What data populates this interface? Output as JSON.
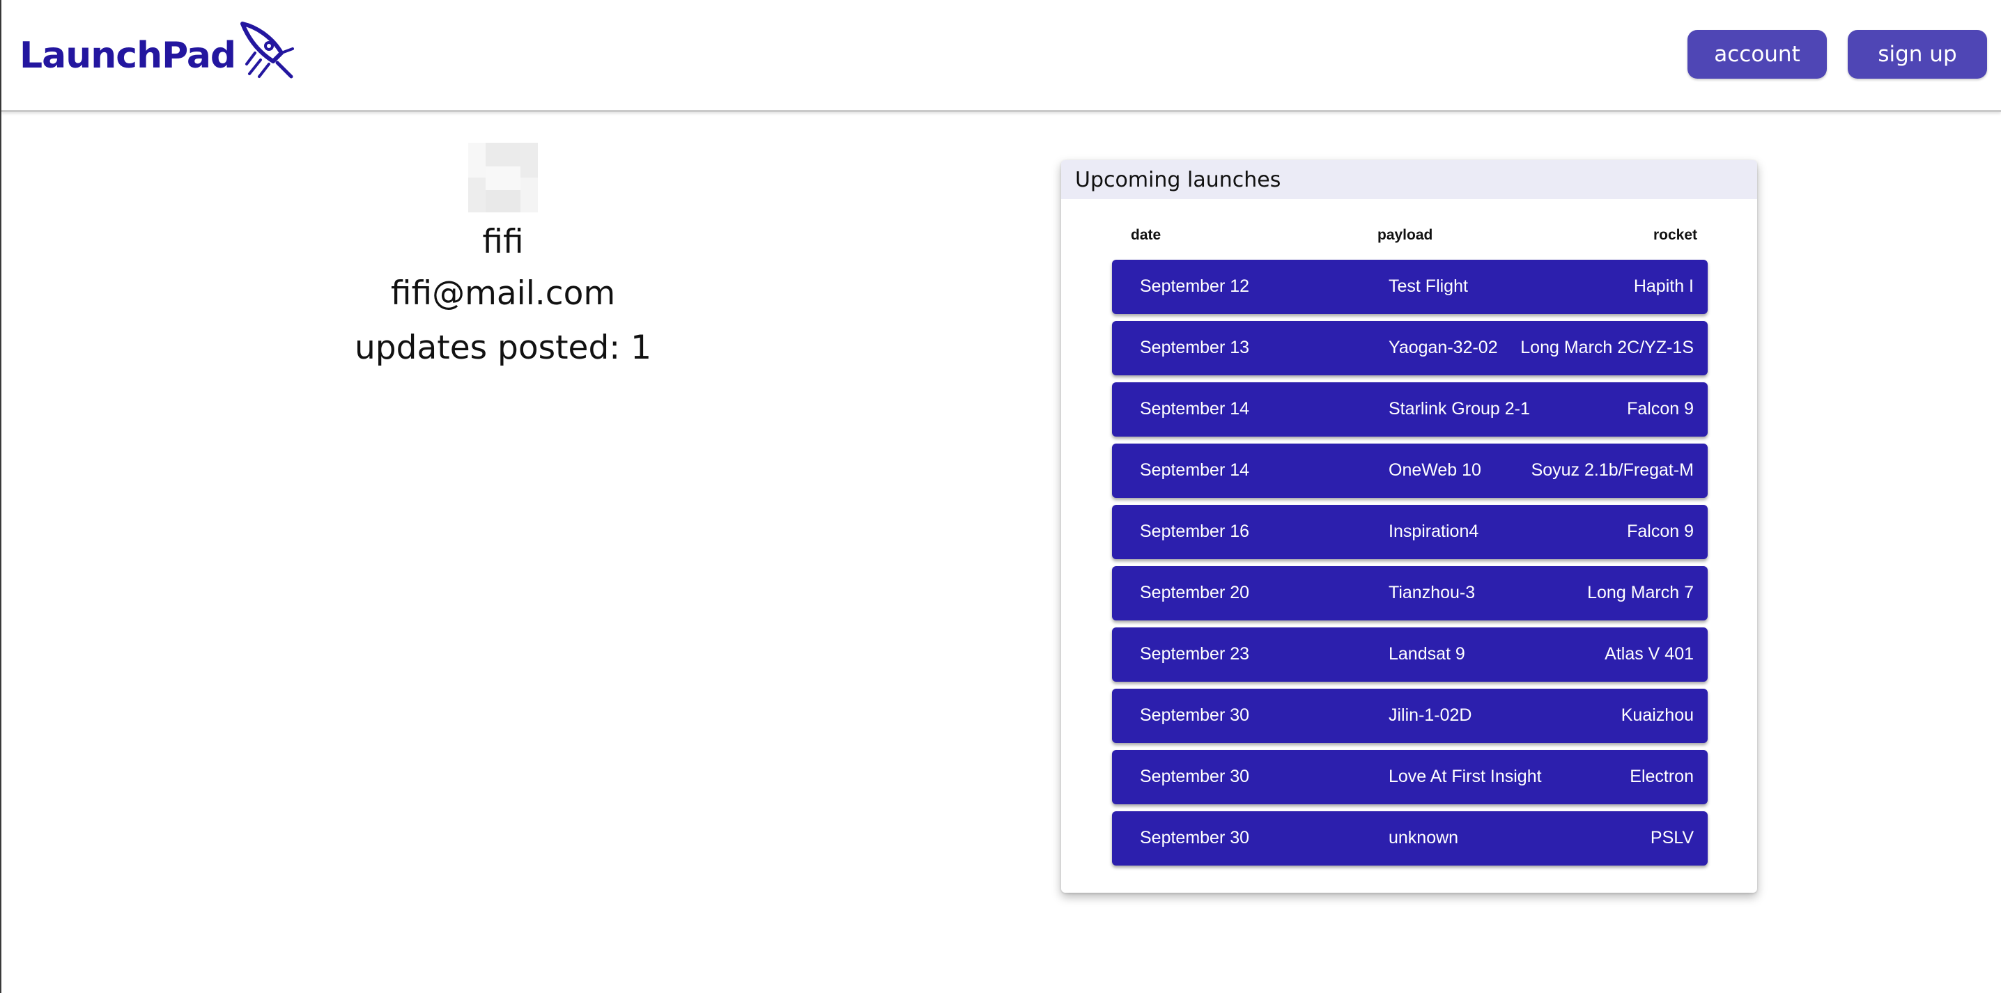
{
  "header": {
    "brand": "LaunchPad",
    "logo_icon": "rocket-icon",
    "account_label": "account",
    "signup_label": "sign up",
    "accent_color": "#4f46b5",
    "brand_color": "#23169f"
  },
  "profile": {
    "avatar_icon": "avatar-placeholder-icon",
    "name": "fifi",
    "email": "fifi@mail.com",
    "updates": "updates posted: 1"
  },
  "launches": {
    "title": "Upcoming launches",
    "columns": {
      "date": "date",
      "payload": "payload",
      "rocket": "rocket"
    },
    "row_color": "#2c1fad",
    "rows": [
      {
        "date": "September 12",
        "payload": "Test Flight",
        "rocket": "Hapith I"
      },
      {
        "date": "September 13",
        "payload": "Yaogan-32-02",
        "rocket": "Long March 2C/YZ-1S"
      },
      {
        "date": "September 14",
        "payload": "Starlink Group 2-1",
        "rocket": "Falcon 9"
      },
      {
        "date": "September 14",
        "payload": "OneWeb 10",
        "rocket": "Soyuz 2.1b/Fregat-M"
      },
      {
        "date": "September 16",
        "payload": "Inspiration4",
        "rocket": "Falcon 9"
      },
      {
        "date": "September 20",
        "payload": "Tianzhou-3",
        "rocket": "Long March 7"
      },
      {
        "date": "September 23",
        "payload": "Landsat 9",
        "rocket": "Atlas V 401"
      },
      {
        "date": "September 30",
        "payload": "Jilin-1-02D",
        "rocket": "Kuaizhou"
      },
      {
        "date": "September 30",
        "payload": "Love At First Insight",
        "rocket": "Electron"
      },
      {
        "date": "September 30",
        "payload": "unknown",
        "rocket": "PSLV"
      }
    ]
  }
}
